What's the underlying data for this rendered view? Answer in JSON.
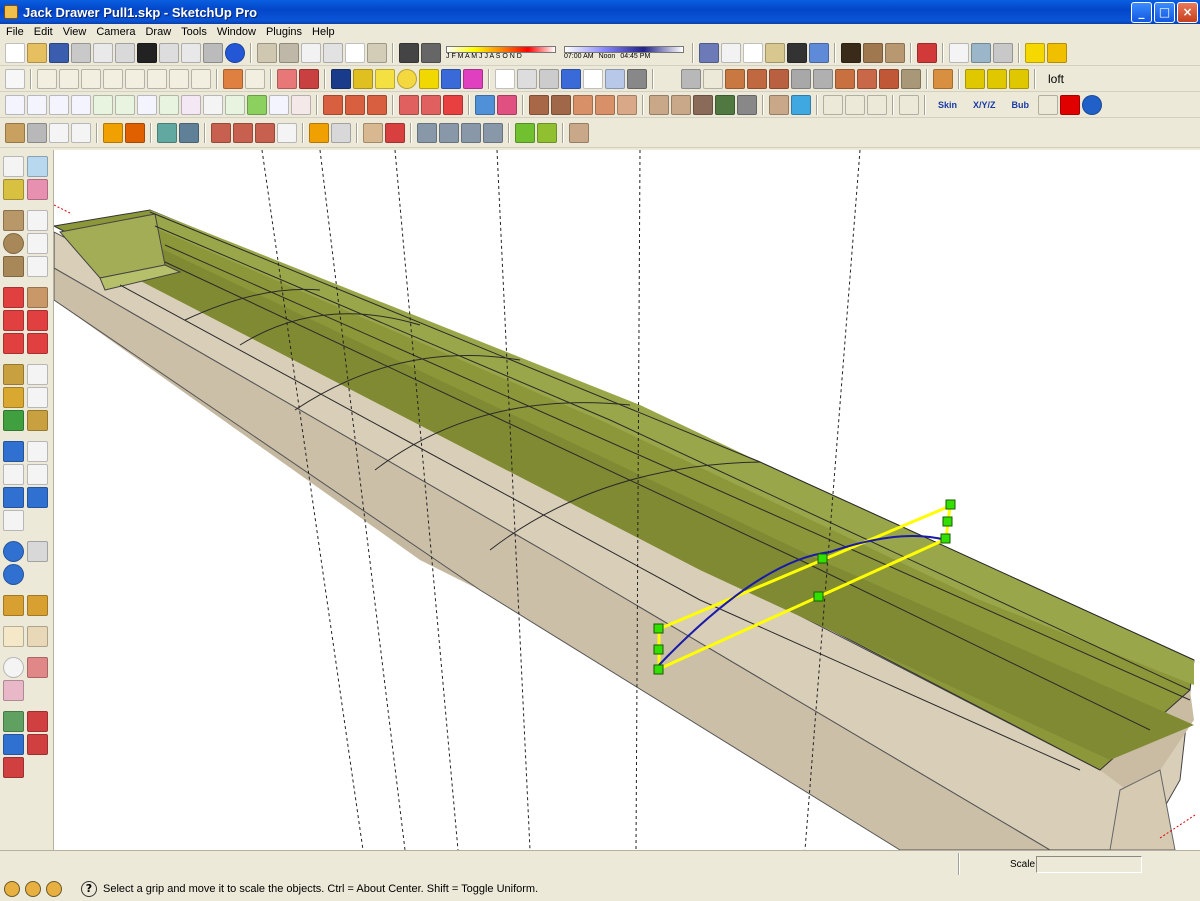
{
  "window": {
    "title": "Jack Drawer Pull1.skp - SketchUp Pro",
    "minimize_glyph": "_",
    "maximize_glyph": "□",
    "close_glyph": "×"
  },
  "menu": [
    "File",
    "Edit",
    "View",
    "Camera",
    "Draw",
    "Tools",
    "Window",
    "Plugins",
    "Help"
  ],
  "shadow_settings": {
    "months": "J F M A M J J A S O N D",
    "morning_time": "07:00 AM",
    "noon_label": "Noon",
    "evening_time": "04:45 PM"
  },
  "plugin_labels": {
    "loft": "loft",
    "skin": "Skin",
    "xyz": "X/Y/Z",
    "bub": "Bub"
  },
  "icon_names": {
    "standard": [
      "new-icon",
      "open-icon",
      "save-icon",
      "cut-icon",
      "copy-icon",
      "paste-icon",
      "erase-icon",
      "undo-icon",
      "redo-icon",
      "print-icon",
      "model-info-icon"
    ],
    "views": [
      "iso-view-icon",
      "top-view-icon",
      "front-view-icon",
      "right-view-icon",
      "back-view-icon",
      "left-view-icon"
    ],
    "styles": [
      "xray-icon",
      "wireframe-icon",
      "hidden-line-icon",
      "shaded-icon",
      "textured-icon",
      "monochrome-icon"
    ]
  },
  "status": {
    "message": "Select a grip and move it to scale the objects. Ctrl = About Center. Shift = Toggle Uniform.",
    "help_glyph": "?"
  },
  "scale": {
    "label": "Scale",
    "value": ""
  },
  "colors": {
    "face_green": "#8f9a3c",
    "side_tan": "#d8ccb6",
    "selection_yellow": "#ffff00",
    "curve_blue": "#1a1aa8",
    "grip_green": "#32e000"
  }
}
